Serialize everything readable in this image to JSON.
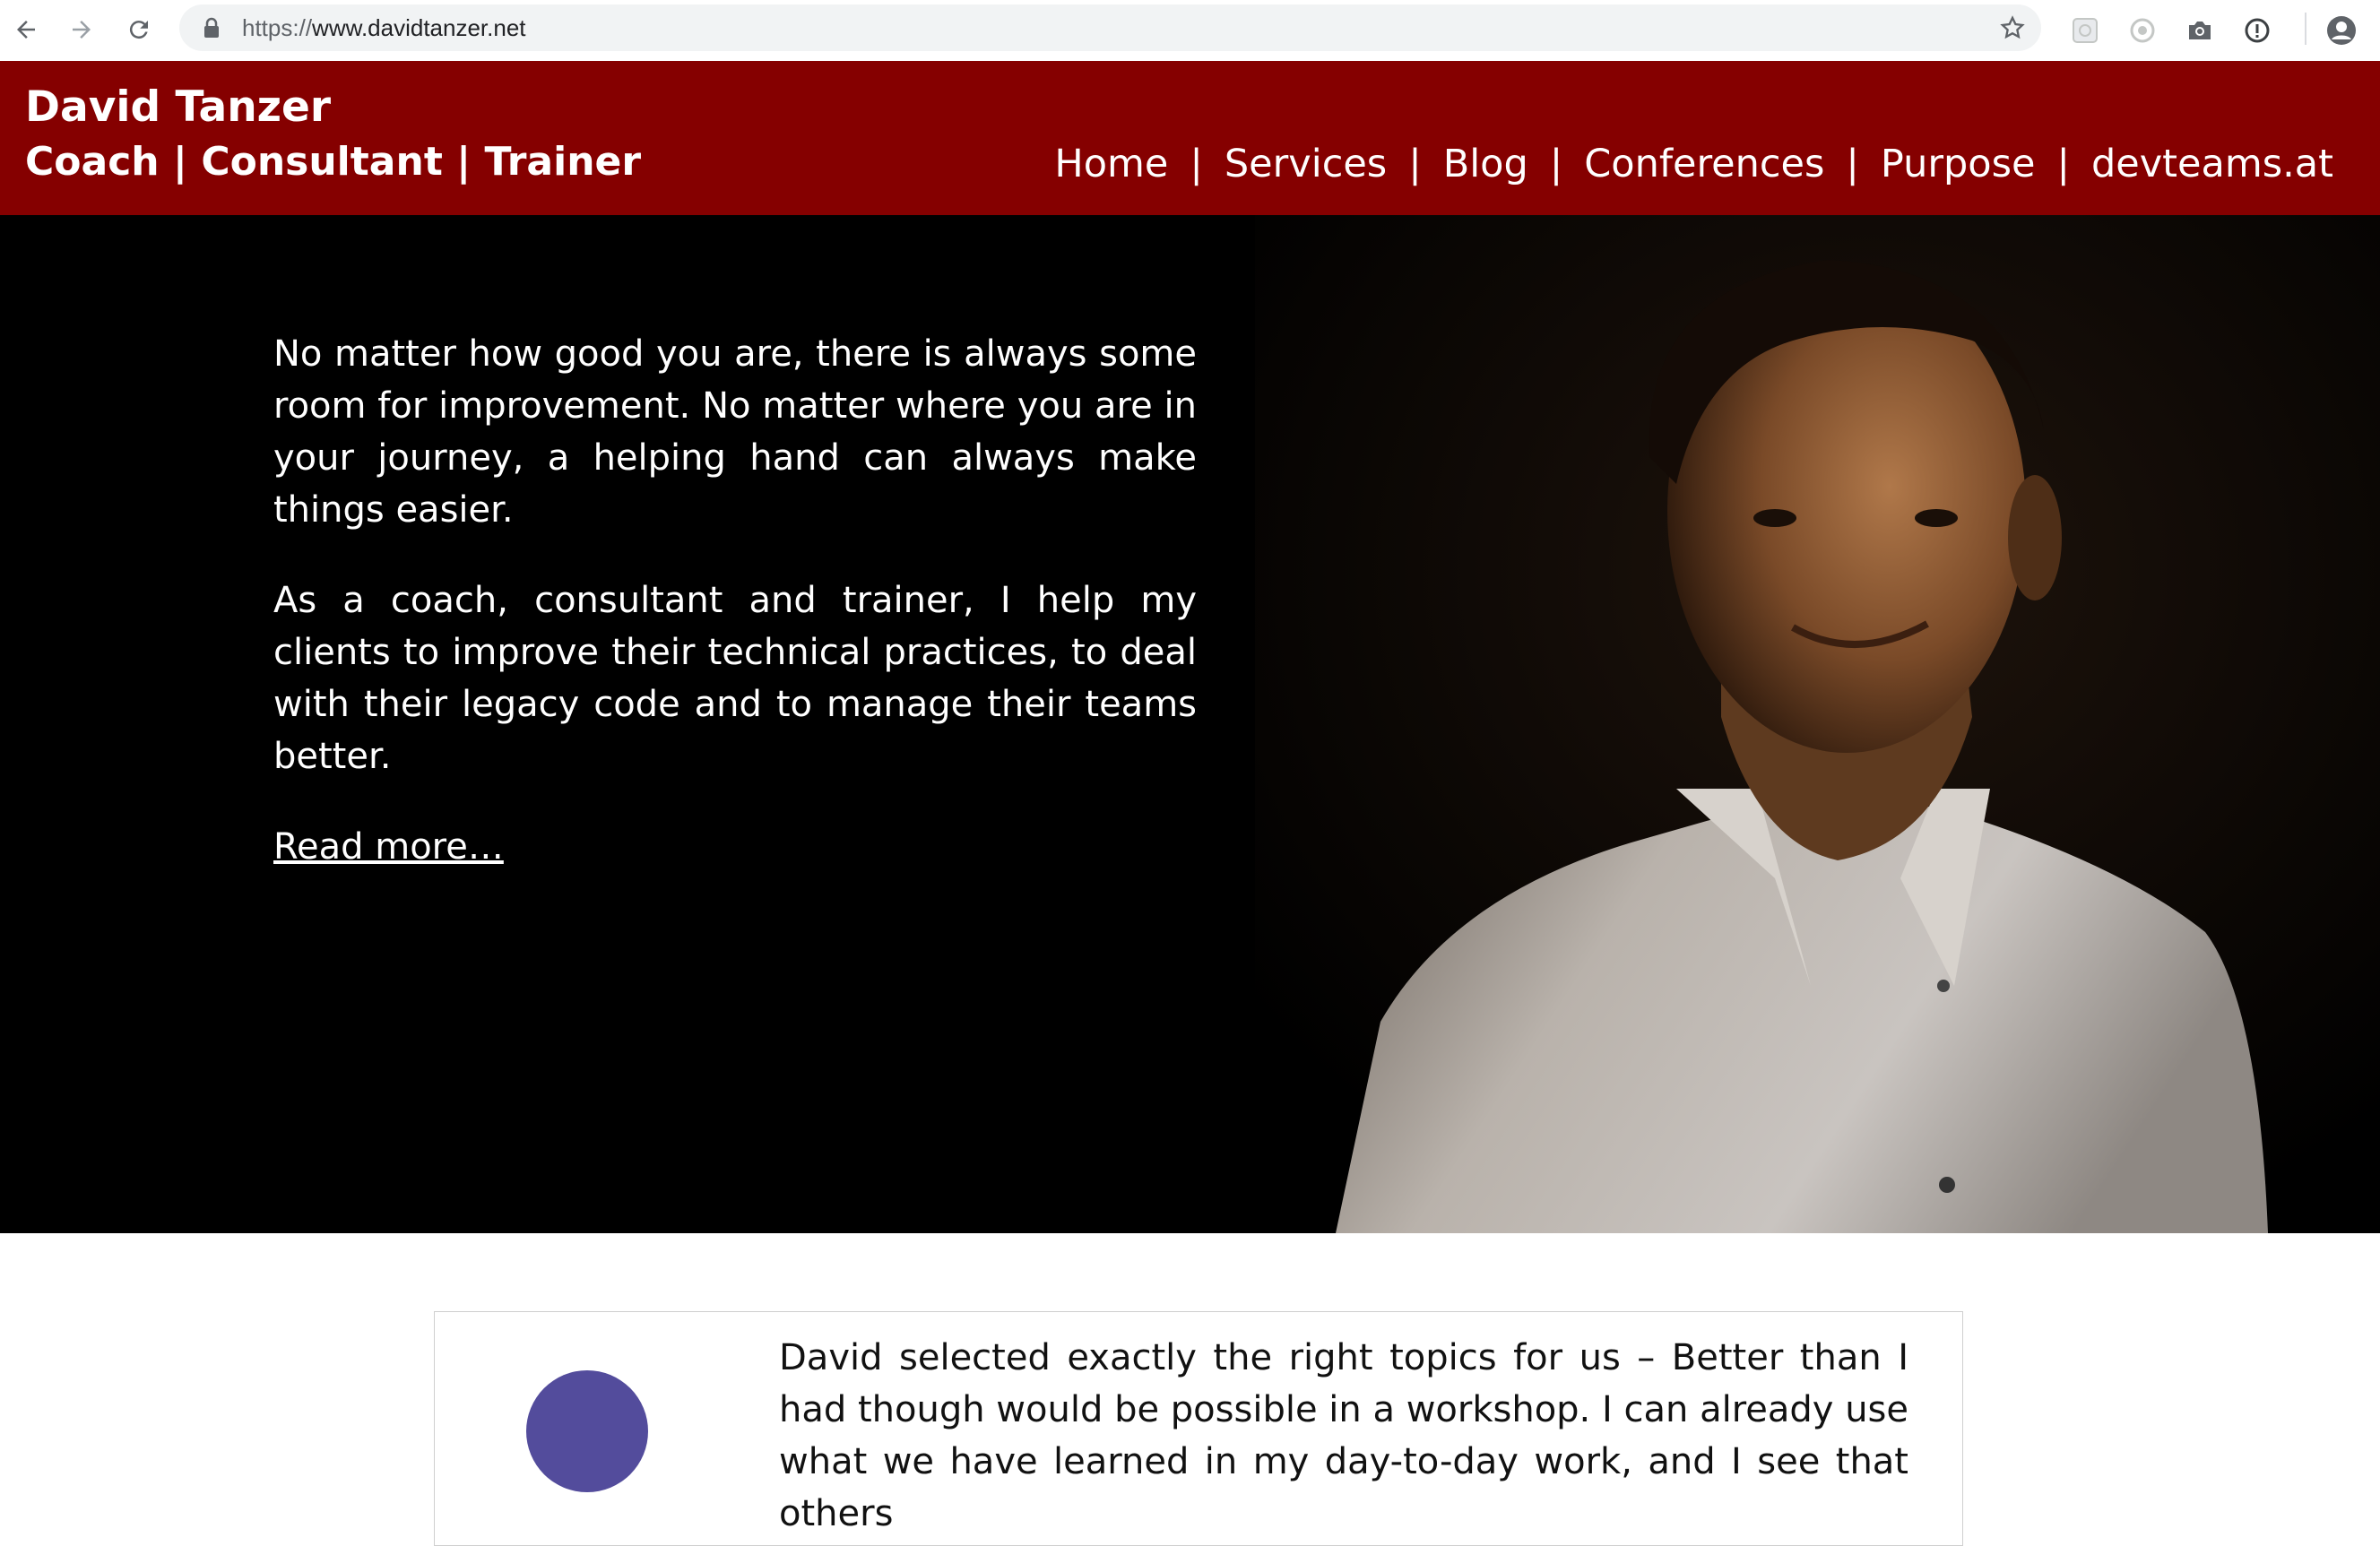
{
  "browser": {
    "url_scheme": "https://",
    "url_host": "www.davidtanzer.net",
    "icons": [
      "back-arrow-icon",
      "forward-arrow-icon",
      "reload-icon",
      "lock-icon",
      "star-icon",
      "extension-icon",
      "extension-icon",
      "camera-icon",
      "info-icon",
      "profile-icon"
    ]
  },
  "header": {
    "name": "David Tanzer",
    "tagline": "Coach | Consultant | Trainer",
    "nav": [
      "Home",
      "Services",
      "Blog",
      "Conferences",
      "Purpose",
      "devteams.at"
    ],
    "separator": "|",
    "background_color": "#850000"
  },
  "hero": {
    "paragraph1": "No matter how good you are, there is always some room for improvement. No matter where you are in your journey, a helping hand can always make things easier.",
    "paragraph2": "As a coach, consultant and trainer, I help my clients to improve their technical practices, to deal with their legacy code and to manage their teams better.",
    "read_more": "Read more…"
  },
  "testimonial": {
    "quote": "David selected exactly the right topics for us – Better than I had though would be possible in a workshop. I can already use what we have learned in my day-to-day work, and I see that others",
    "avatar_color": "#534c9c"
  }
}
